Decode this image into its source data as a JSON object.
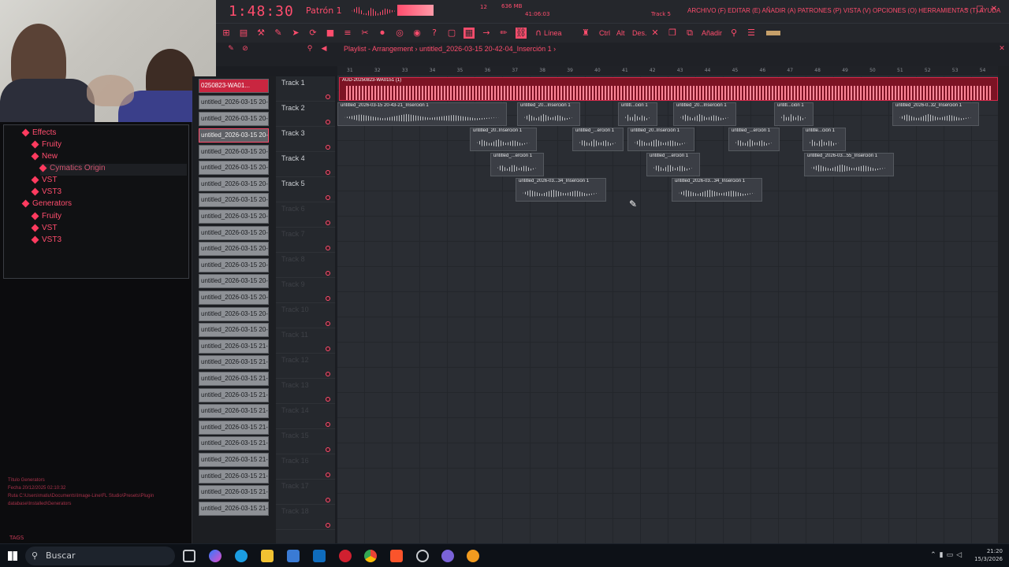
{
  "topbar": {
    "time": "1:48:30",
    "pattern": "Patrón 1",
    "menu": "ARCHIVO (F) EDITAR (E) AÑADIR (A) PATRONES (P) VISTA (V) OPCIONES (O) HERRAMIENTAS (T) AYUDA",
    "hint_track": "Track 5",
    "memory": "636 MB",
    "cpu": "12",
    "position": "41:06:03"
  },
  "toolbar": {
    "line_label": "Línea",
    "ctrl_label": "Ctrl",
    "alt_label": "Alt",
    "des_label": "Des.",
    "add_label": "Añadir"
  },
  "playlist": {
    "title": "Playlist - Arrangement › untitled_2026-03-15 20-42-04_Inserción 1 ›"
  },
  "browser": {
    "items": [
      {
        "label": "Effects",
        "level": 0
      },
      {
        "label": "Fruity",
        "level": 1
      },
      {
        "label": "New",
        "level": 1
      },
      {
        "label": "Cymatics Origin",
        "level": 2
      },
      {
        "label": "VST",
        "level": 1
      },
      {
        "label": "VST3",
        "level": 1
      },
      {
        "label": "Generators",
        "level": 0
      },
      {
        "label": "Fruity",
        "level": 1
      },
      {
        "label": "VST",
        "level": 1
      },
      {
        "label": "VST3",
        "level": 1
      }
    ],
    "info_title": "Título  Generators",
    "info_date": "Fecha  20/12/2025 02:10:32",
    "info_path": "Ruta   C:\\Users\\matiu\\Documents\\Image-Line\\FL Studio\\Presets\\Plugin database\\Installed\\Generators",
    "tags": "TAGS"
  },
  "clips_list": [
    "0250823-WA01...",
    "untitled_2026-03-15 20-...",
    "untitled_2026-03-15 20-...",
    "untitled_2026-03-15 20-...",
    "untitled_2026-03-15 20-...",
    "untitled_2026-03-15 20-...",
    "untitled_2026-03-15 20-...",
    "untitled_2026-03-15 20-...",
    "untitled_2026-03-15 20-...",
    "untitled_2026-03-15 20-...",
    "untitled_2026-03-15 20-...",
    "untitled_2026-03-15 20-...",
    "untitled_2026-03-15 20-...",
    "untitled_2026-03-15 20-...",
    "untitled_2026-03-15 20-...",
    "untitled_2026-03-15 20-...",
    "untitled_2026-03-15 21-...",
    "untitled_2026-03-15 21-...",
    "untitled_2026-03-15 21-...",
    "untitled_2026-03-15 21-...",
    "untitled_2026-03-15 21-...",
    "untitled_2026-03-15 21-...",
    "untitled_2026-03-15 21-...",
    "untitled_2026-03-15 21-...",
    "untitled_2026-03-15 21-...",
    "untitled_2026-03-15 21-...",
    "untitled_2026-03-15 21-..."
  ],
  "tracks": [
    "Track 1",
    "Track 2",
    "Track 3",
    "Track 4",
    "Track 5",
    "Track 6",
    "Track 7",
    "Track 8",
    "Track 9",
    "Track 10",
    "Track 11",
    "Track 12",
    "Track 13",
    "Track 14",
    "Track 15",
    "Track 16",
    "Track 17",
    "Track 18"
  ],
  "ruler": [
    "31",
    "32",
    "33",
    "34",
    "35",
    "36",
    "37",
    "38",
    "39",
    "40",
    "41",
    "42",
    "43",
    "44",
    "45",
    "46",
    "47",
    "48",
    "49",
    "50",
    "51",
    "52",
    "53",
    "54"
  ],
  "arrangement": [
    {
      "track": 0,
      "title": "AUD-20250823-WA0151 (1)",
      "red": true
    },
    {
      "track": 1,
      "title": "untitled_2026-03-15 20-43-21_Inserción 1"
    },
    {
      "track": 1,
      "title": "untitled_20...Inserción 1"
    },
    {
      "track": 1,
      "title": "untitl...ción 1"
    },
    {
      "track": 1,
      "title": "untitled_20...Inserción 1"
    },
    {
      "track": 1,
      "title": "untitl...ción 1"
    },
    {
      "track": 1,
      "title": "untitled_2026-0..32_Inserción 1"
    },
    {
      "track": 2,
      "title": "untitled_20..Inserción 1"
    },
    {
      "track": 2,
      "title": "untitled_...erción 1"
    },
    {
      "track": 2,
      "title": "untitled_20..Inserción 1"
    },
    {
      "track": 2,
      "title": "untitled_...erción 1"
    },
    {
      "track": 2,
      "title": "untitle...ción 1"
    },
    {
      "track": 3,
      "title": "untitled_...erción 1"
    },
    {
      "track": 3,
      "title": "untitled_...erción 1"
    },
    {
      "track": 3,
      "title": "untitled_2026-03...55_Inserción 1"
    },
    {
      "track": 4,
      "title": "untitled_2026-03...34_Inserción 1"
    },
    {
      "track": 4,
      "title": "untitled_2026-03...34_Inserción 1"
    }
  ],
  "taskbar": {
    "search_placeholder": "Buscar",
    "time": "21:20",
    "date": "15/3/2026"
  }
}
